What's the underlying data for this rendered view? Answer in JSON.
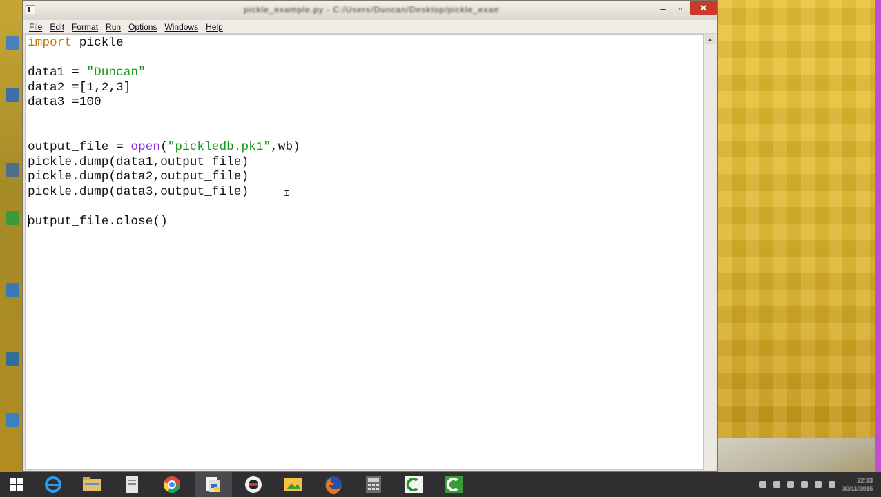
{
  "window": {
    "title": "pickle_example.py - C:/Users/Duncan/Desktop/pickle_example.py",
    "minimize": "–",
    "maximize": "▫",
    "close": "✕"
  },
  "menubar": {
    "items": [
      "File",
      "Edit",
      "Format",
      "Run",
      "Options",
      "Windows",
      "Help"
    ]
  },
  "editor": {
    "lines": [
      "import pickle",
      "",
      "data1 = \"Duncan\"",
      "data2 =[1,2,3]",
      "data3 =100",
      "",
      "",
      "output_file = open(\"pickledb.pk1\",wb)",
      "pickle.dump(data1,output_file)",
      "pickle.dump(data2,output_file)",
      "pickle.dump(data3,output_file)",
      "",
      "output_file.close()"
    ],
    "mouse_cursor": "I"
  },
  "taskbar": {
    "apps": [
      "start-icon",
      "ie-icon",
      "file-explorer-icon",
      "document-icon",
      "chrome-icon",
      "idle-icon",
      "camera-icon",
      "photos-icon",
      "firefox-icon",
      "calculator-icon",
      "camtasia-icon",
      "camtasia-recorder-icon"
    ],
    "clock_time": "22:33",
    "clock_date": "30/11/2015"
  },
  "colors": {
    "keyword": "#c87a00",
    "string": "#1a9a1a",
    "builtin": "#8a2be2",
    "taskbar": "#2f2f31",
    "close_button": "#c83a2c"
  }
}
